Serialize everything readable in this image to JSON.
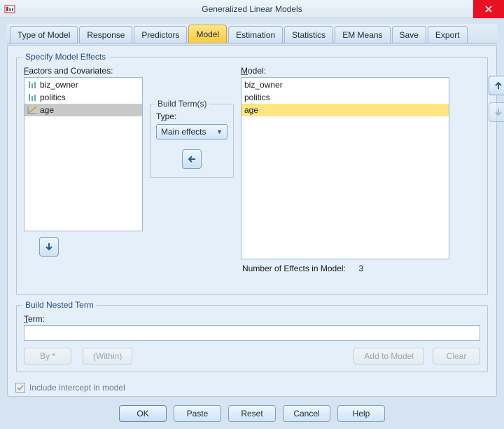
{
  "window": {
    "title": "Generalized Linear Models"
  },
  "tabs": [
    {
      "label": "Type of Model"
    },
    {
      "label": "Response"
    },
    {
      "label": "Predictors"
    },
    {
      "label": "Model",
      "active": true
    },
    {
      "label": "Estimation"
    },
    {
      "label": "Statistics"
    },
    {
      "label": "EM Means"
    },
    {
      "label": "Save"
    },
    {
      "label": "Export"
    }
  ],
  "specify": {
    "legend": "Specify Model Effects",
    "factors_label": "Factors and Covariates:",
    "model_label": "Model:",
    "factors": [
      {
        "name": "biz_owner",
        "kind": "categorical"
      },
      {
        "name": "politics",
        "kind": "categorical"
      },
      {
        "name": "age",
        "kind": "scale",
        "selected": true
      }
    ],
    "model_items": [
      {
        "name": "biz_owner"
      },
      {
        "name": "politics"
      },
      {
        "name": "age",
        "highlighted": true
      }
    ],
    "effects_count_label": "Number of Effects in Model:",
    "effects_count": "3"
  },
  "buildterm": {
    "legend": "Build Term(s)",
    "type_label": "Type:",
    "type_value": "Main effects"
  },
  "nested": {
    "legend": "Build Nested Term",
    "term_label": "Term:",
    "term_value": "",
    "by_label": "By *",
    "within_label": "(Within)",
    "add_label": "Add to Model",
    "clear_label": "Clear"
  },
  "include_intercept": {
    "label": "Include intercept in model",
    "checked": true,
    "disabled": true
  },
  "buttons": {
    "ok": "OK",
    "paste": "Paste",
    "reset": "Reset",
    "cancel": "Cancel",
    "help": "Help"
  }
}
